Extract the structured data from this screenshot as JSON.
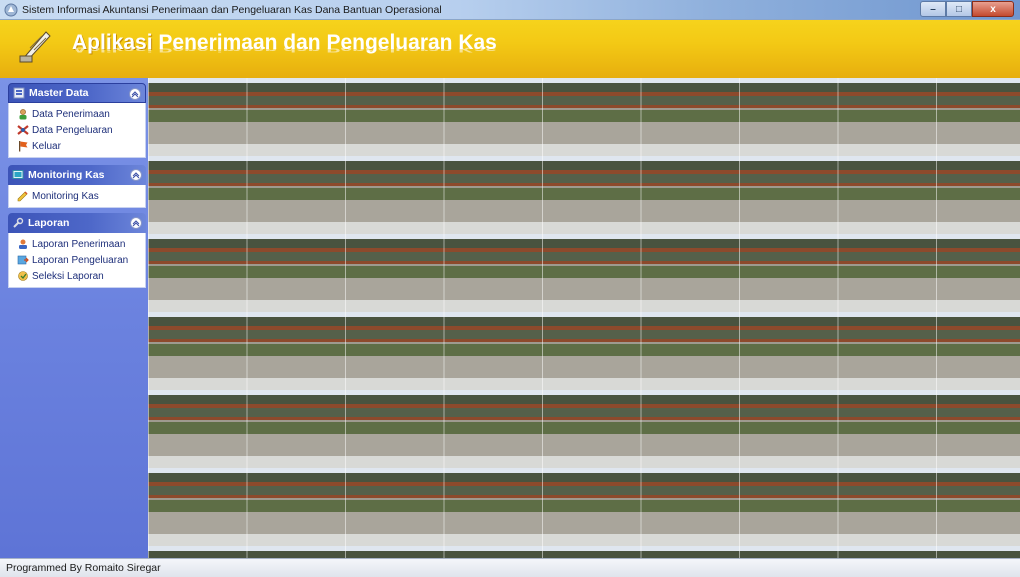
{
  "window": {
    "title": "Sistem Informasi Akuntansi Penerimaan dan Pengeluaran Kas Dana Bantuan Operasional",
    "controls": {
      "minimize": "–",
      "maximize": "□",
      "close": "x"
    }
  },
  "banner": {
    "word1": "Aplikasi",
    "word2": "Penerimaan dan Pengeluaran Kas",
    "reflection": "Aplikasi Penerimaan dan Pengeluaran Kas",
    "accent_color": "#f3c915"
  },
  "sidebar": {
    "groups": [
      {
        "title": "Master Data",
        "items": [
          {
            "label": "Data Penerimaan",
            "icon": "user-icon"
          },
          {
            "label": "Data Pengeluaran",
            "icon": "money-icon"
          },
          {
            "label": "Keluar",
            "icon": "flag-icon"
          }
        ]
      },
      {
        "title": "Monitoring Kas",
        "items": [
          {
            "label": "Monitoring Kas",
            "icon": "pencil-icon"
          }
        ]
      },
      {
        "title": "Laporan",
        "items": [
          {
            "label": "Laporan Penerimaan",
            "icon": "report-icon"
          },
          {
            "label": "Laporan Pengeluaran",
            "icon": "report-out-icon"
          },
          {
            "label": "Seleksi Laporan",
            "icon": "filter-icon"
          }
        ]
      }
    ]
  },
  "main": {
    "background": "tiled-school-building-photo"
  },
  "status": {
    "text": "Programmed By Romaito Siregar"
  }
}
